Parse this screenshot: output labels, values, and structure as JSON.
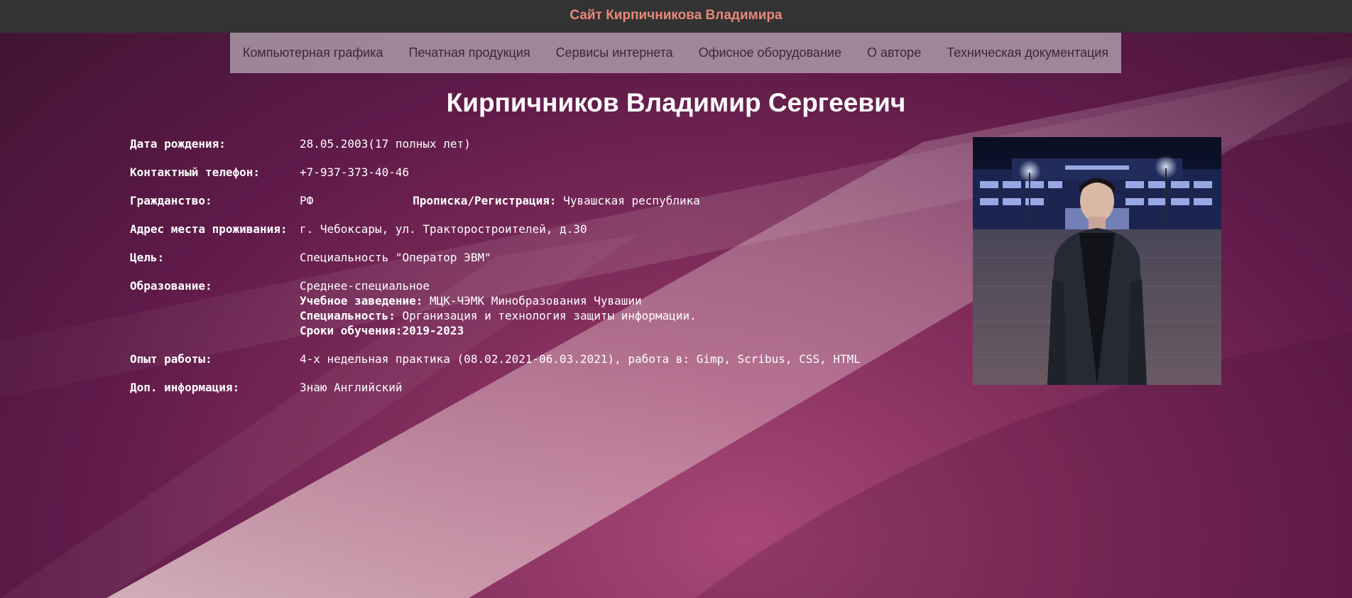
{
  "header": {
    "site_title": "Сайт Кирпичникова Владимира"
  },
  "nav": {
    "items": [
      "Компьютерная графика",
      "Печатная продукция",
      "Сервисы интернета",
      "Офисное оборудование",
      "О авторе",
      "Техническая документация"
    ]
  },
  "page_title": "Кирпичников Владимир Сергеевич",
  "profile": {
    "birth": {
      "label": "Дата рождения:",
      "value": "28.05.2003(17 полных лет)"
    },
    "phone": {
      "label": "Контактный телефон:",
      "value": "+7-937-373-40-46"
    },
    "citizenship": {
      "label": "Гражданство:",
      "value": "РФ",
      "registration_label": "Прописка/Регистрация:",
      "registration_value": "Чувашская республика"
    },
    "address": {
      "label": "Адрес места проживания:",
      "value": "г. Чебоксары, ул. Тракторостроителей, д.30"
    },
    "goal": {
      "label": "Цель:",
      "value": "Специальность \"Оператор ЭВМ\""
    },
    "education": {
      "label": "Образование:",
      "value": "Среднее-специальное",
      "institution_label": "Учебное заведение:",
      "institution_value": "МЦК-ЧЭМК Минобразования Чувашии",
      "specialty_label": "Специальность:",
      "specialty_value": "Организация и технология защиты информации.",
      "period_label": "Сроки обучения:",
      "period_value": "2019-2023"
    },
    "experience": {
      "label": "Опыт работы:",
      "value": "4-х недельная практика (08.02.2021-06.03.2021), работа в: Gimp, Scribus, CSS, HTML"
    },
    "extra": {
      "label": "Доп. информация:",
      "value": "Знаю Английский"
    }
  },
  "photo": {
    "icon": "portrait-photo"
  }
}
